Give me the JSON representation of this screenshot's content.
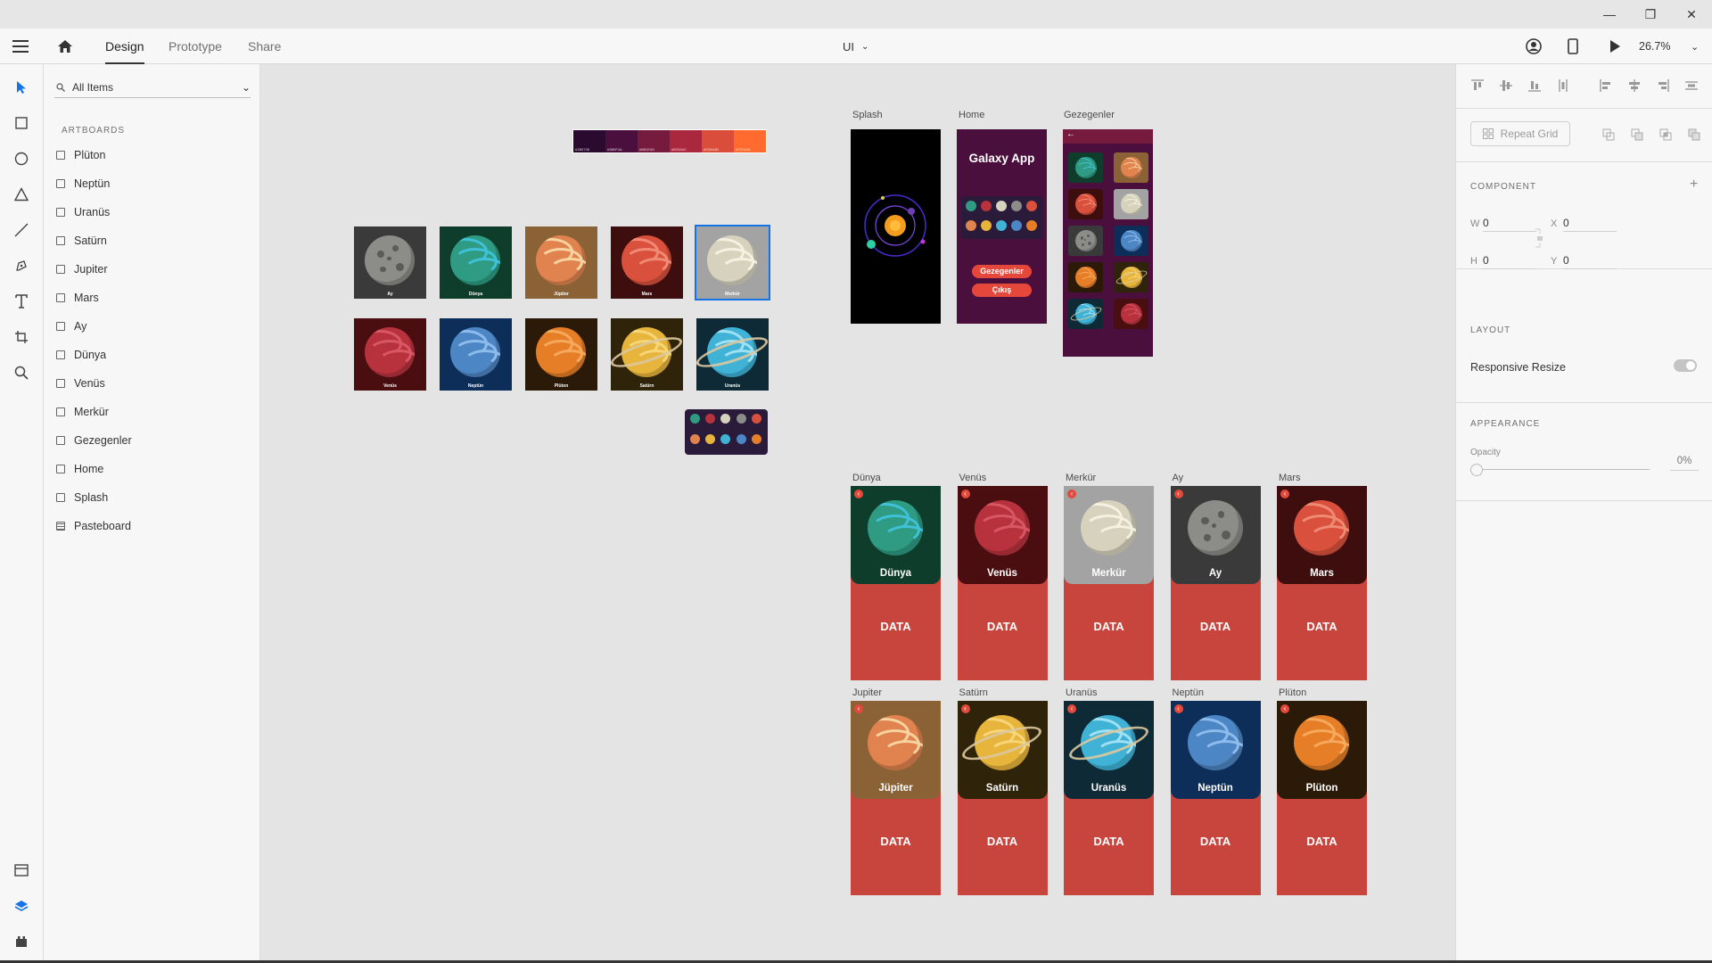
{
  "window": {
    "minimize": "—",
    "restore": "❐",
    "close": "✕"
  },
  "appbar": {
    "tabs": [
      "Design",
      "Prototype",
      "Share"
    ],
    "doc_title": "UI",
    "zoom": "26.7%"
  },
  "layers_panel": {
    "search_placeholder": "All Items",
    "section": "ARTBOARDS",
    "items": [
      "Plüton",
      "Neptün",
      "Uranüs",
      "Satürn",
      "Jupiter",
      "Mars",
      "Ay",
      "Dünya",
      "Venüs",
      "Merkür",
      "Gezegenler",
      "Home",
      "Splash",
      "Pasteboard"
    ]
  },
  "canvas": {
    "palette_labels": [
      "#1B0726",
      "#3B0F4A",
      "#6B1E4D",
      "#B33A4C",
      "#E05A3B",
      "#F37A2A"
    ],
    "palette_colors": [
      "#2a0a2e",
      "#4a0f3d",
      "#761a3e",
      "#a9283d",
      "#d94d3a",
      "#ff6a2f"
    ],
    "tiles_row1": [
      "Ay",
      "Dünya",
      "Jüpiter",
      "Mars",
      "Merkür"
    ],
    "tiles_row2": [
      "Venüs",
      "Neptün",
      "Plüton",
      "Satürn",
      "Uranüs"
    ],
    "artboards_top": [
      "Splash",
      "Home",
      "Gezegenler"
    ],
    "home": {
      "title": "Galaxy App",
      "btn1": "Gezegenler",
      "btn2": "Çıkış"
    },
    "details_row1": [
      {
        "label": "Dünya",
        "name": "Dünya"
      },
      {
        "label": "Venüs",
        "name": "Venüs"
      },
      {
        "label": "Merkür",
        "name": "Merkür"
      },
      {
        "label": "Ay",
        "name": "Ay"
      },
      {
        "label": "Mars",
        "name": "Mars"
      }
    ],
    "details_row2": [
      {
        "label": "Jupiter",
        "name": "Jüpiter"
      },
      {
        "label": "Satürn",
        "name": "Satürn"
      },
      {
        "label": "Uranüs",
        "name": "Uranüs"
      },
      {
        "label": "Neptün",
        "name": "Neptün"
      },
      {
        "label": "Plüton",
        "name": "Plüton"
      }
    ],
    "data_label": "DATA"
  },
  "props": {
    "repeat_grid": "Repeat Grid",
    "component": "COMPONENT",
    "w_label": "W",
    "w": "0",
    "h_label": "H",
    "h": "0",
    "x_label": "X",
    "x": "0",
    "y_label": "Y",
    "y": "0",
    "layout": "LAYOUT",
    "responsive_resize": "Responsive Resize",
    "appearance": "APPEARANCE",
    "opacity_label": "Opacity",
    "opacity": "0%"
  }
}
